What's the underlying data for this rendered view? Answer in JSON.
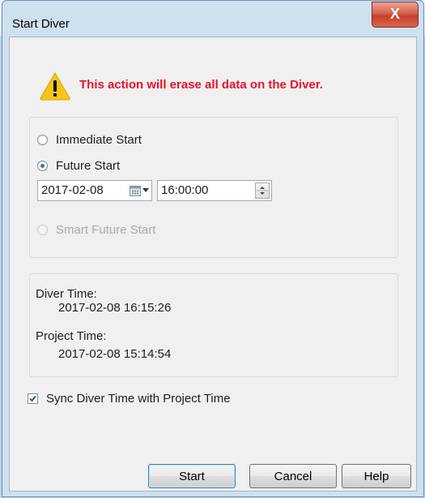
{
  "dialog": {
    "title": "Start Diver",
    "close_label": "X"
  },
  "warning": {
    "text": "This action will erase all data on the Diver."
  },
  "start_options": {
    "immediate_label": "Immediate Start",
    "future_label": "Future Start",
    "selected": "future",
    "date_value": "2017-02-08",
    "time_value": "16:00:00",
    "smart_future_label": "Smart Future Start"
  },
  "times": {
    "diver_label": "Diver Time:",
    "diver_value": "2017-02-08 16:15:26",
    "project_label": "Project Time:",
    "project_value": "2017-02-08 15:14:54"
  },
  "sync": {
    "label": "Sync Diver Time with Project Time",
    "checked": true
  },
  "buttons": {
    "start": "Start",
    "cancel": "Cancel",
    "help": "Help"
  },
  "colors": {
    "warning_text": "#e8132a",
    "warning_icon": "#f5c518"
  }
}
